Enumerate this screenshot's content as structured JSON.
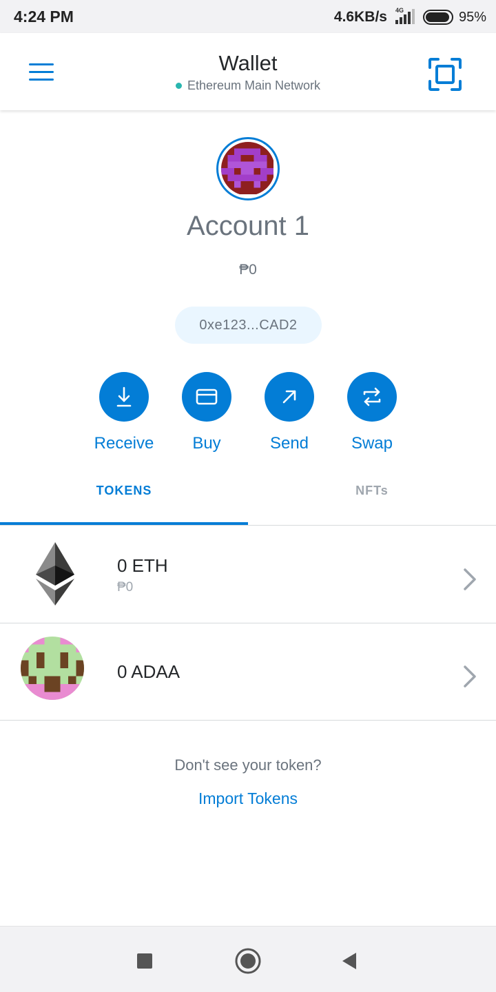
{
  "status_bar": {
    "time": "4:24 PM",
    "net_speed": "4.6KB/s",
    "network_type": "4G",
    "battery_level": 0.95,
    "battery_pct": "95%"
  },
  "header": {
    "title": "Wallet",
    "network": "Ethereum Main Network",
    "menu_icon": "hamburger-menu-icon",
    "scan_icon": "qr-scan-icon"
  },
  "account": {
    "name": "Account 1",
    "balance": "₱0",
    "address": "0xe123...CAD2",
    "avatar_icon": "identicon-avatar"
  },
  "actions": [
    {
      "label": "Receive",
      "icon": "receive-icon"
    },
    {
      "label": "Buy",
      "icon": "card-icon"
    },
    {
      "label": "Send",
      "icon": "send-arrow-icon"
    },
    {
      "label": "Swap",
      "icon": "swap-icon"
    }
  ],
  "tabs": [
    {
      "label": "TOKENS",
      "active": true
    },
    {
      "label": "NFTs",
      "active": false
    }
  ],
  "tokens": [
    {
      "amount": "0 ETH",
      "fiat": "₱0",
      "icon": "ethereum-icon"
    },
    {
      "amount": "0 ADAA",
      "icon": "token-identicon"
    }
  ],
  "footer": {
    "prompt": "Don't see your token?",
    "import_label": "Import Tokens"
  },
  "navbar": {
    "items": [
      "recents-icon",
      "home-icon",
      "back-icon"
    ]
  },
  "colors": {
    "accent": "#037dd6",
    "network_dot": "#29b6af",
    "muted_text": "#6a737d",
    "address_pill_bg": "#eaf6ff"
  }
}
